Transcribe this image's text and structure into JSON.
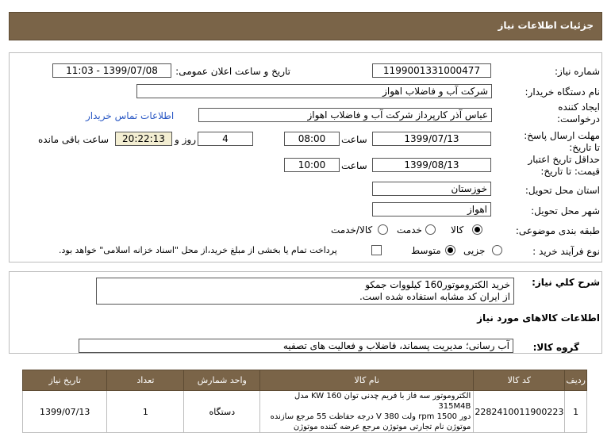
{
  "title": "جزئیات اطلاعات نیاز",
  "fields": {
    "need_number_label": "شماره نیاز:",
    "need_number": "1199001331000477",
    "announce_label": "تاریخ و ساعت اعلان عمومی:",
    "announce_value": "1399/07/08 - 11:03",
    "buyer_label": "نام دستگاه خریدار:",
    "buyer_value": "شرکت آب و فاضلاب اهواز",
    "creator_label": "ایجاد کننده درخواست:",
    "creator_value": "عباس آذر کارپرداز شرکت آب و فاضلاب اهواز",
    "contact_link": "اطلاعات تماس خریدار",
    "send_deadline_label": "مهلت ارسال پاسخ: تا تاریخ:",
    "send_date": "1399/07/13",
    "time_label": "ساعت",
    "send_time": "08:00",
    "days_value": "4",
    "days_label": "روز و",
    "remaining_time": "20:22:13",
    "remaining_label": "ساعت باقی مانده",
    "validity_label": "حداقل تاریخ اعتبار قیمت: تا تاریخ:",
    "validity_date": "1399/08/13",
    "validity_time": "10:00",
    "province_label": "استان محل تحویل:",
    "province_value": "خوزستان",
    "city_label": "شهر محل تحویل:",
    "city_value": "اهواز",
    "category_label": "طبقه بندی موضوعی:",
    "category_options": [
      "کالا",
      "خدمت",
      "کالا/خدمت"
    ],
    "process_label": "نوع فرآیند خرید :",
    "process_options": [
      "جزیی",
      "متوسط"
    ],
    "payment_note": "پرداخت تمام یا بخشی از مبلغ خرید،از محل \"اسناد خزانه اسلامی\" خواهد بود."
  },
  "description": {
    "label": "شرح کلي نیاز:",
    "line1": "خرید الکتروموتور160 کیلووات جمکو",
    "line2": "از ایران کد مشابه استفاده شده است."
  },
  "goods_info_title": "اطلاعات کالاهای مورد نیاز",
  "group": {
    "label": "گروه کالا:",
    "value": "آب رسانی؛ مدیریت پسماند، فاضلاب و فعالیت های تصفیه"
  },
  "table": {
    "headers": [
      "ردیف",
      "کد کالا",
      "نام کالا",
      "واحد شمارش",
      "تعداد",
      "تاریخ نیاز"
    ],
    "row": {
      "index": "1",
      "code": "2282410011900223",
      "name1": "الکتروموتور سه فاز با فریم چدنی توان 160 KW مدل 315M4B",
      "name2": "دور 1500 rpm ولت 380 V درجه حفاظت 55 مرجع سازنده",
      "name3": "موتوژن نام تجارتی موتوژن مرجع عرضه کننده موتوژن",
      "unit": "دستگاه",
      "qty": "1",
      "date": "1399/07/13"
    }
  },
  "colors": {
    "header_bg": "#7a6448",
    "remaining_bg": "#f3eed2",
    "link": "#2a58c4"
  }
}
